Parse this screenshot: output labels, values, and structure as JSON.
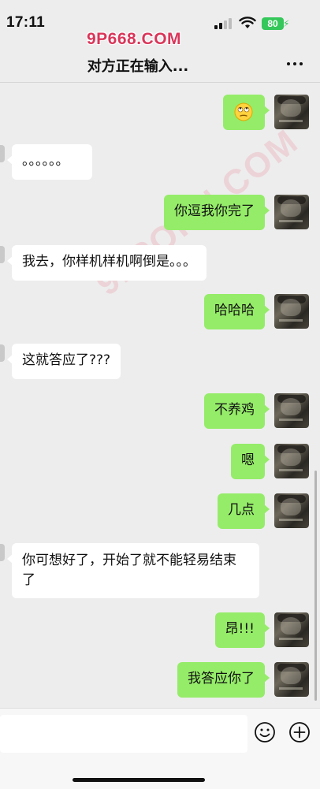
{
  "status_bar": {
    "time": "17:11",
    "battery": "80"
  },
  "watermark": {
    "top_text": "9P668.COM",
    "diagonal_text": "91PORN.COM"
  },
  "header": {
    "title": "对方正在输入..."
  },
  "messages": [
    {
      "sender": "me",
      "type": "emoji",
      "emoji": "rolling-eyes-emoji"
    },
    {
      "sender": "other",
      "text": "。。。。。。"
    },
    {
      "sender": "me",
      "text": "你逗我你完了"
    },
    {
      "sender": "other",
      "text": "我去，你样机样机啊倒是。。。"
    },
    {
      "sender": "me",
      "text": "哈哈哈"
    },
    {
      "sender": "other",
      "text": "这就答应了???"
    },
    {
      "sender": "me",
      "text": "不养鸡"
    },
    {
      "sender": "me",
      "text": "嗯"
    },
    {
      "sender": "me",
      "text": "几点"
    },
    {
      "sender": "other",
      "text": "你可想好了，开始了就不能轻易结束了"
    },
    {
      "sender": "me",
      "text": "昂!!!"
    },
    {
      "sender": "me",
      "text": "我答应你了"
    }
  ],
  "input": {
    "value": "",
    "placeholder": ""
  },
  "colors": {
    "my_bubble": "#95ec69",
    "other_bubble": "#ffffff",
    "background": "#ededed",
    "battery": "#34c759",
    "watermark": "#d9365a"
  }
}
